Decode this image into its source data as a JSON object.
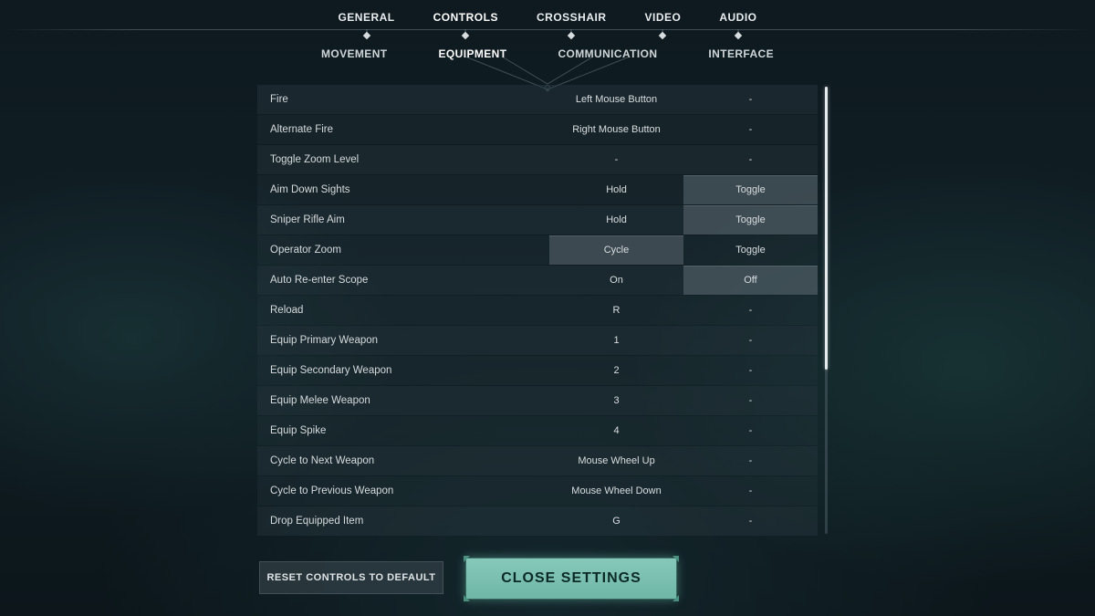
{
  "top_tabs": [
    "GENERAL",
    "CONTROLS",
    "CROSSHAIR",
    "VIDEO",
    "AUDIO"
  ],
  "top_active_index": 1,
  "sub_tabs": [
    "MOVEMENT",
    "EQUIPMENT",
    "COMMUNICATION",
    "INTERFACE"
  ],
  "sub_active_index": 1,
  "rows": [
    {
      "label": "Fire",
      "c1": "Left Mouse Button",
      "c2": "-",
      "sel1": false,
      "sel2": false
    },
    {
      "label": "Alternate Fire",
      "c1": "Right Mouse Button",
      "c2": "-",
      "sel1": false,
      "sel2": false
    },
    {
      "label": "Toggle Zoom Level",
      "c1": "-",
      "c2": "-",
      "sel1": false,
      "sel2": false
    },
    {
      "label": "Aim Down Sights",
      "c1": "Hold",
      "c2": "Toggle",
      "sel1": false,
      "sel2": true
    },
    {
      "label": "Sniper Rifle Aim",
      "c1": "Hold",
      "c2": "Toggle",
      "sel1": false,
      "sel2": true
    },
    {
      "label": "Operator Zoom",
      "c1": "Cycle",
      "c2": "Toggle",
      "sel1": true,
      "sel2": false
    },
    {
      "label": "Auto Re-enter Scope",
      "c1": "On",
      "c2": "Off",
      "sel1": false,
      "sel2": true
    },
    {
      "label": "Reload",
      "c1": "R",
      "c2": "-",
      "sel1": false,
      "sel2": false
    },
    {
      "label": "Equip Primary Weapon",
      "c1": "1",
      "c2": "-",
      "sel1": false,
      "sel2": false
    },
    {
      "label": "Equip Secondary Weapon",
      "c1": "2",
      "c2": "-",
      "sel1": false,
      "sel2": false
    },
    {
      "label": "Equip Melee Weapon",
      "c1": "3",
      "c2": "-",
      "sel1": false,
      "sel2": false
    },
    {
      "label": "Equip Spike",
      "c1": "4",
      "c2": "-",
      "sel1": false,
      "sel2": false
    },
    {
      "label": "Cycle to Next Weapon",
      "c1": "Mouse Wheel Up",
      "c2": "-",
      "sel1": false,
      "sel2": false
    },
    {
      "label": "Cycle to Previous Weapon",
      "c1": "Mouse Wheel Down",
      "c2": "-",
      "sel1": false,
      "sel2": false
    },
    {
      "label": "Drop Equipped Item",
      "c1": "G",
      "c2": "-",
      "sel1": false,
      "sel2": false
    }
  ],
  "buttons": {
    "reset": "RESET CONTROLS TO DEFAULT",
    "close": "CLOSE SETTINGS"
  }
}
